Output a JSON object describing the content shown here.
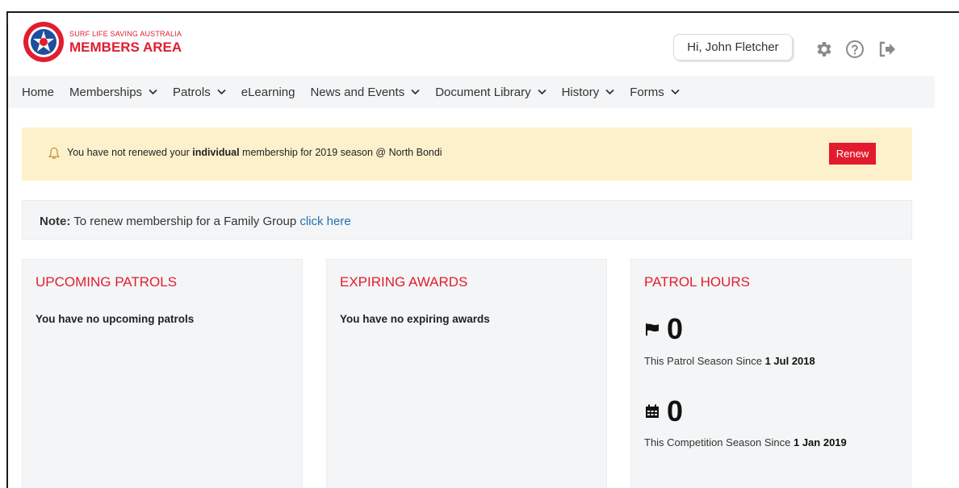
{
  "brand": {
    "org_name": "SURF LIFE SAVING AUSTRALIA",
    "area_name": "MEMBERS AREA",
    "logo_words": "SURF LIFE SAVING"
  },
  "header": {
    "greeting": "Hi, John Fletcher",
    "icons": [
      "gear-icon",
      "help-icon",
      "logout-icon"
    ]
  },
  "nav": {
    "items": [
      {
        "label": "Home",
        "dropdown": false
      },
      {
        "label": "Memberships",
        "dropdown": true
      },
      {
        "label": "Patrols",
        "dropdown": true
      },
      {
        "label": "eLearning",
        "dropdown": false
      },
      {
        "label": "News and Events",
        "dropdown": true
      },
      {
        "label": "Document Library",
        "dropdown": true
      },
      {
        "label": "History",
        "dropdown": true
      },
      {
        "label": "Forms",
        "dropdown": true
      }
    ]
  },
  "alert": {
    "text_before": "You have not renewed your ",
    "text_bold": "individual",
    "text_after": " membership for 2019 season @ North Bondi",
    "button_label": "Renew"
  },
  "note": {
    "label": "Note:",
    "text": " To renew membership for a Family Group ",
    "link_text": "click here"
  },
  "cards": {
    "upcoming_patrols": {
      "title": "UPCOMING PATROLS",
      "empty_text": "You have no upcoming patrols"
    },
    "expiring_awards": {
      "title": "EXPIRING AWARDS",
      "empty_text": "You have no expiring awards"
    },
    "patrol_hours": {
      "title": "PATROL HOURS",
      "patrol_value": "0",
      "patrol_caption": "This Patrol Season Since ",
      "patrol_since": "1 Jul 2018",
      "competition_value": "0",
      "competition_caption": "This Competition Season Since ",
      "competition_since": "1 Jan 2019"
    }
  },
  "colors": {
    "brand_red": "#e11d2e",
    "alert_bg": "#fdf1cc",
    "panel_bg": "#f4f5f6",
    "link_blue": "#1f6fb5"
  }
}
